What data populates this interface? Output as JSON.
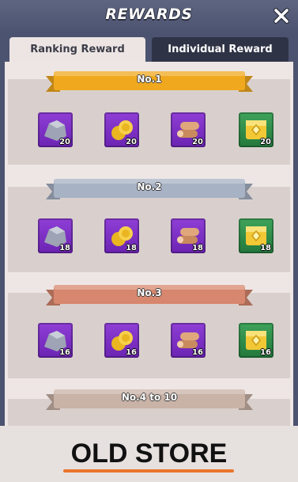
{
  "header": {
    "title": "REWARDS",
    "close_icon": "close-icon"
  },
  "tabs": [
    {
      "label": "Ranking Reward",
      "active": true
    },
    {
      "label": "Individual Reward",
      "active": false
    }
  ],
  "ranks": [
    {
      "label": "No.1",
      "banner_color": "#f0a91f",
      "items": [
        {
          "icon": "silver-ore-icon",
          "quantity": "20"
        },
        {
          "icon": "gold-coins-icon",
          "quantity": "20"
        },
        {
          "icon": "wood-logs-icon",
          "quantity": "20"
        },
        {
          "icon": "gold-chest-icon",
          "quantity": "20"
        }
      ]
    },
    {
      "label": "No.2",
      "banner_color": "#a7b2c4",
      "items": [
        {
          "icon": "silver-ore-icon",
          "quantity": "18"
        },
        {
          "icon": "gold-coins-icon",
          "quantity": "18"
        },
        {
          "icon": "wood-logs-icon",
          "quantity": "18"
        },
        {
          "icon": "gold-chest-icon",
          "quantity": "18"
        }
      ]
    },
    {
      "label": "No.3",
      "banner_color": "#d7876e",
      "items": [
        {
          "icon": "silver-ore-icon",
          "quantity": "16"
        },
        {
          "icon": "gold-coins-icon",
          "quantity": "16"
        },
        {
          "icon": "wood-logs-icon",
          "quantity": "16"
        },
        {
          "icon": "gold-chest-icon",
          "quantity": "16"
        }
      ]
    },
    {
      "label": "No.4 to 10",
      "banner_color": "#c9b2a6",
      "items": []
    }
  ],
  "footer": {
    "text": "OLD STORE",
    "underline_color": "#e8742a"
  }
}
